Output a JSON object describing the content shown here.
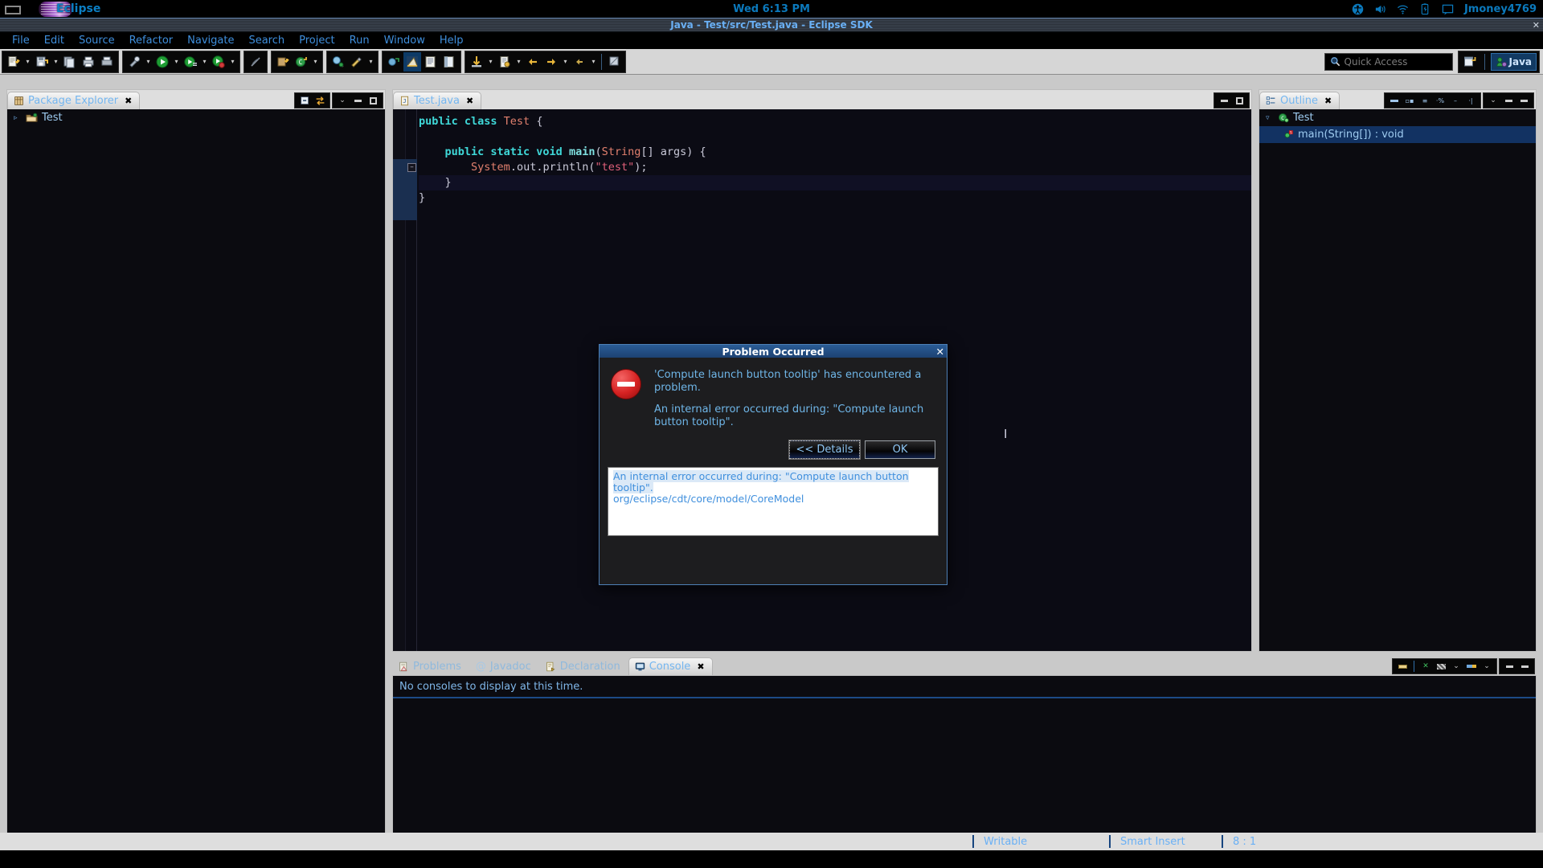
{
  "os_panel": {
    "app_name": "Eclipse",
    "clock": "Wed  6:13 PM",
    "user": "Jmoney4769",
    "tray_icons": [
      "accessibility-icon",
      "volume-icon",
      "wifi-icon",
      "battery-icon",
      "notification-icon"
    ]
  },
  "window": {
    "title": "Java - Test/src/Test.java - Eclipse SDK",
    "close_label": "✕"
  },
  "menubar": {
    "items": [
      "File",
      "Edit",
      "Source",
      "Refactor",
      "Navigate",
      "Search",
      "Project",
      "Run",
      "Window",
      "Help"
    ]
  },
  "toolbar": {
    "quick_access": {
      "placeholder": "Quick Access",
      "value": "",
      "icon": "search-icon"
    },
    "perspective": {
      "label": "Java",
      "open_perspective_icon": "open-perspective-icon"
    }
  },
  "package_explorer": {
    "tab_label": "Package Explorer",
    "tab_icon": "package-explorer-icon",
    "close_label": "✖",
    "tools": [
      "collapse-all-icon",
      "link-with-editor-icon",
      "view-menu-icon",
      "minimize-icon",
      "maximize-icon"
    ],
    "tree": [
      {
        "label": "Test",
        "icon": "java-project-icon",
        "expanded": false,
        "twisty": "▹"
      }
    ]
  },
  "editor": {
    "tab_label": "Test.java",
    "tab_icon": "java-file-icon",
    "close_label": "✖",
    "status_line": "8 : 1",
    "lines": [
      {
        "indent": 0,
        "tokens": [
          {
            "t": "public ",
            "c": "k"
          },
          {
            "t": "class ",
            "c": "k"
          },
          {
            "t": "Test",
            "c": "t"
          },
          {
            "t": " {",
            "c": "p"
          }
        ]
      },
      {
        "indent": 0,
        "tokens": []
      },
      {
        "indent": 1,
        "tokens": [
          {
            "t": "public ",
            "c": "k"
          },
          {
            "t": "static ",
            "c": "k"
          },
          {
            "t": "void ",
            "c": "k"
          },
          {
            "t": "main",
            "c": "m"
          },
          {
            "t": "(",
            "c": "p"
          },
          {
            "t": "String",
            "c": "t"
          },
          {
            "t": "[] args) {",
            "c": "p"
          }
        ]
      },
      {
        "indent": 2,
        "tokens": [
          {
            "t": "System",
            "c": "t"
          },
          {
            "t": ".out.println(",
            "c": "p"
          },
          {
            "t": "\"test\"",
            "c": "s"
          },
          {
            "t": ");",
            "c": "p"
          }
        ]
      },
      {
        "indent": 1,
        "tokens": [
          {
            "t": "}",
            "c": "p"
          }
        ]
      },
      {
        "indent": 0,
        "tokens": [
          {
            "t": "}",
            "c": "p"
          }
        ]
      }
    ]
  },
  "outline": {
    "tab_label": "Outline",
    "tab_icon": "outline-icon",
    "close_label": "✖",
    "tree": [
      {
        "label": "Test",
        "icon": "java-class-icon",
        "twisty": "▿",
        "selected": false,
        "depth": 0
      },
      {
        "label": "main(String[]) : void",
        "icon": "java-method-icon",
        "twisty": "",
        "selected": true,
        "depth": 1
      }
    ]
  },
  "bottom_panel": {
    "tabs": [
      {
        "label": "Problems",
        "icon": "problems-icon",
        "active": false
      },
      {
        "label": "Javadoc",
        "icon": "javadoc-icon",
        "active": false
      },
      {
        "label": "Declaration",
        "icon": "declaration-icon",
        "active": false
      },
      {
        "label": "Console",
        "icon": "console-icon",
        "active": true
      }
    ],
    "close_label": "✖",
    "message": "No consoles to display at this time."
  },
  "statusbar": {
    "writable": "Writable",
    "insert_mode": "Smart Insert",
    "position": "8 : 1"
  },
  "dialog": {
    "title": "Problem Occurred",
    "close_label": "✕",
    "icon": "error-icon",
    "message_1": "'Compute launch button tooltip' has encountered a problem.",
    "message_2": "An internal error occurred during: \"Compute launch button tooltip\".",
    "details_button": "<< Details",
    "ok_button": "OK",
    "details_text": "An internal error occurred during: \"Compute launch button tooltip\".",
    "details_text_2": " org/eclipse/cdt/core/model/CoreModel"
  },
  "colors": {
    "accent_blue": "#3f8fdd",
    "tab_text": "#74b6f0",
    "selection": "#123262",
    "error_red": "#d62222",
    "title_blue": "#2a5c96"
  }
}
